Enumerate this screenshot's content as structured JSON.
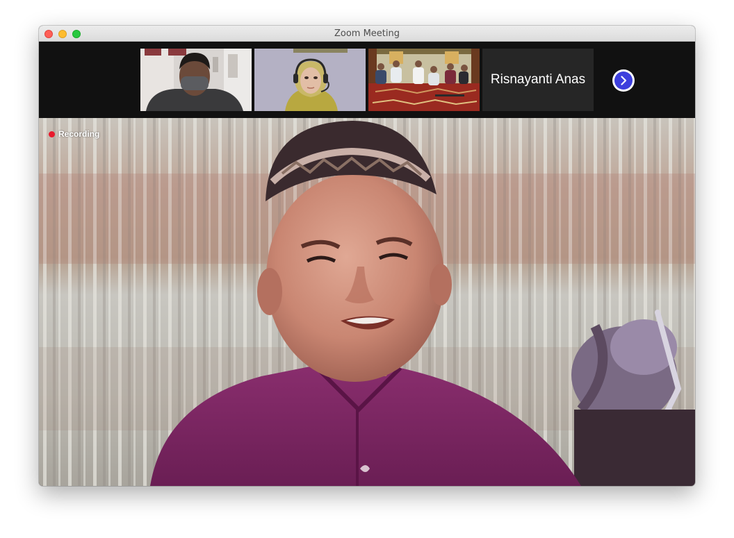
{
  "window": {
    "title": "Zoom Meeting"
  },
  "gallery": {
    "tiles": [
      {
        "type": "video"
      },
      {
        "type": "video"
      },
      {
        "type": "video"
      },
      {
        "type": "name",
        "name": "Risnayanti Anas"
      }
    ],
    "next_icon": "chevron-right-icon"
  },
  "main": {
    "recording_label": "Recording"
  },
  "colors": {
    "recording": "#e8192c",
    "next_button": "#3d3fdd"
  }
}
